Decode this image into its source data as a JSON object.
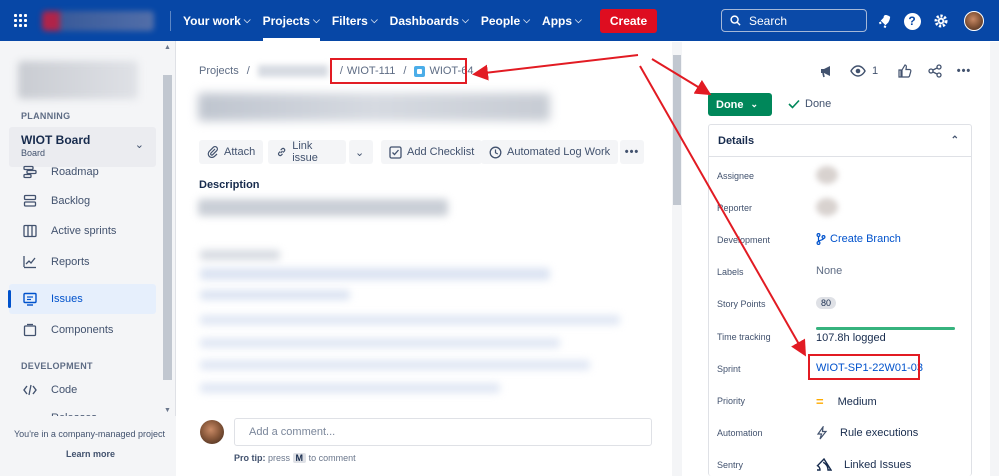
{
  "topnav": {
    "items": [
      {
        "label": "Your work",
        "active": false
      },
      {
        "label": "Projects",
        "active": true
      },
      {
        "label": "Filters",
        "active": false
      },
      {
        "label": "Dashboards",
        "active": false
      },
      {
        "label": "People",
        "active": false
      },
      {
        "label": "Apps",
        "active": false
      }
    ],
    "create_label": "Create",
    "search_placeholder": "Search",
    "colors": {
      "bar": "#0747a6",
      "create": "#de0d20"
    }
  },
  "sidebar": {
    "planning_heading": "PLANNING",
    "board_title": "WIOT Board",
    "board_subtitle": "Board",
    "planning_items": [
      {
        "label": "Roadmap",
        "icon": "roadmap-icon"
      },
      {
        "label": "Backlog",
        "icon": "backlog-icon"
      },
      {
        "label": "Active sprints",
        "icon": "board-columns-icon"
      },
      {
        "label": "Reports",
        "icon": "chart-line-icon"
      },
      {
        "label": "Issues",
        "icon": "issues-icon",
        "selected": true
      },
      {
        "label": "Components",
        "icon": "components-icon"
      }
    ],
    "development_heading": "DEVELOPMENT",
    "development_items": [
      {
        "label": "Code",
        "icon": "code-icon"
      },
      {
        "label": "Releases",
        "icon": "ship-icon"
      }
    ],
    "footer_text": "You're in a company-managed project",
    "footer_link": "Learn more"
  },
  "breadcrumb": {
    "projects": "Projects",
    "parent": "WIOT-111",
    "current": "WIOT-64"
  },
  "actions": {
    "attach": "Attach",
    "link_issue": "Link issue",
    "add_checklist": "Add Checklist",
    "automated_log_work": "Automated Log Work"
  },
  "description_label": "Description",
  "comment": {
    "placeholder": "Add a comment...",
    "pro_tip": "Pro tip:",
    "press": "press",
    "key": "M",
    "to_comment": "to comment"
  },
  "right_panel": {
    "watch_count": "1",
    "status_button": "Done",
    "resolution": "Done",
    "details_title": "Details",
    "fields": [
      {
        "label": "Assignee"
      },
      {
        "label": "Reporter"
      },
      {
        "label": "Development",
        "value": "Create Branch"
      },
      {
        "label": "Labels",
        "value": "None"
      },
      {
        "label": "Story Points",
        "value": "80"
      },
      {
        "label": "Time tracking",
        "value": "107.8h logged",
        "progress": 1.0
      },
      {
        "label": "Sprint",
        "value": "WIOT-SP1-22W01-03"
      },
      {
        "label": "Priority",
        "value": "Medium"
      },
      {
        "label": "Automation",
        "value": "Rule executions"
      },
      {
        "label": "Sentry",
        "value": "Linked Issues"
      }
    ]
  }
}
